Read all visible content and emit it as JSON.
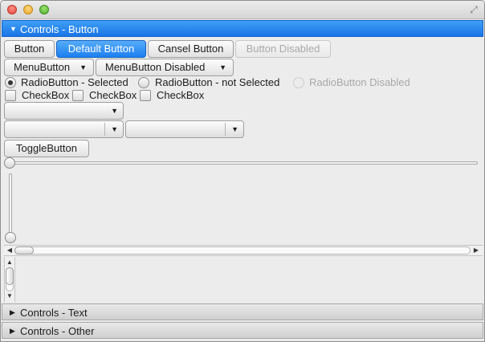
{
  "panes": {
    "button": {
      "label": "Controls - Button",
      "expanded": true
    },
    "text": {
      "label": "Controls - Text",
      "expanded": false
    },
    "other": {
      "label": "Controls - Other",
      "expanded": false
    }
  },
  "buttons": {
    "button": "Button",
    "default": "Default Button",
    "cancel": "Cansel Button",
    "disabled": "Button Disabled"
  },
  "menus": {
    "menu_button": "MenuButton",
    "menu_button_disabled": "MenuButton Disabled"
  },
  "radios": {
    "selected": "RadioButton - Selected",
    "not_selected": "RadioButton - not Selected",
    "disabled": "RadioButton Disabled"
  },
  "checkboxes": {
    "first": "CheckBox",
    "second": "CheckBox",
    "third": "CheckBox"
  },
  "toggle": {
    "label": "ToggleButton"
  },
  "colors": {
    "accent": "#1a75e6",
    "accent_light": "#56acfa",
    "disabled_text": "#a9a9a9"
  },
  "icons": {
    "expanded": "triangle-down",
    "collapsed": "triangle-right",
    "dropdown": "triangle-down"
  }
}
